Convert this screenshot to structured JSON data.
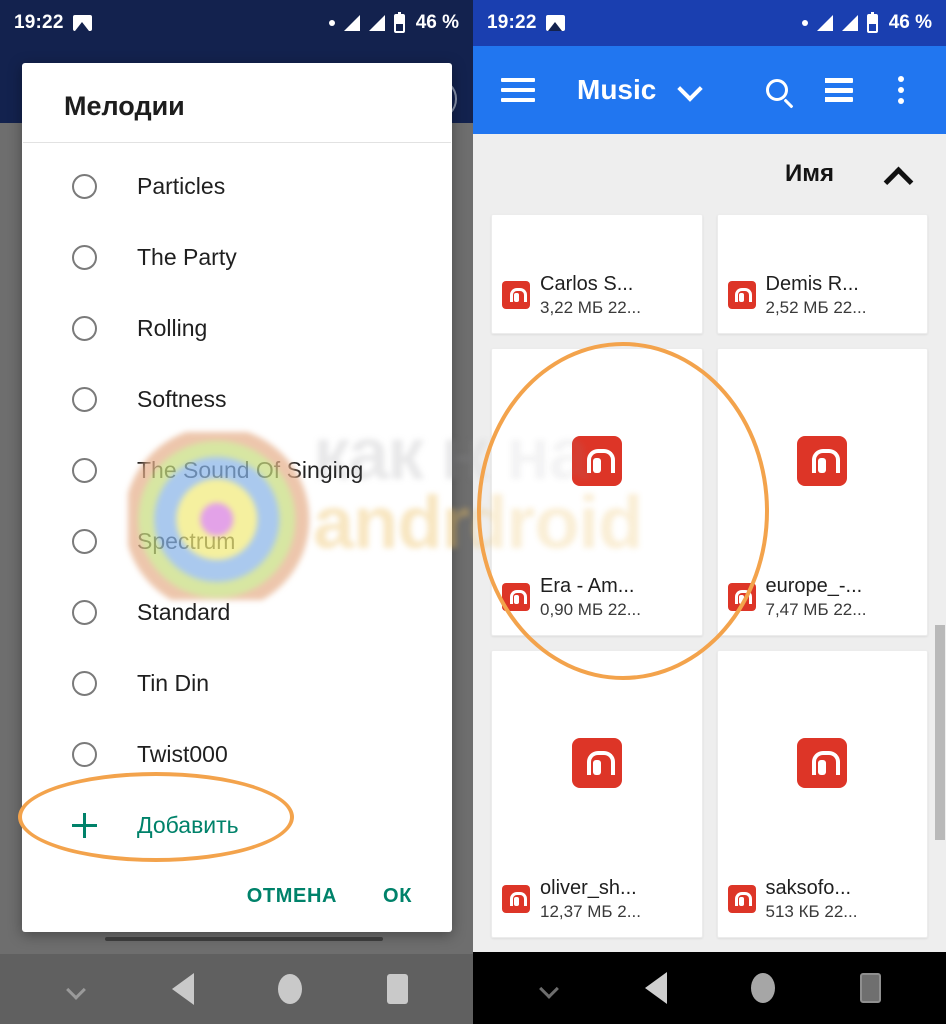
{
  "status_bar": {
    "time": "19:22",
    "battery_percent": "46 %",
    "image_icon": "image-icon",
    "dot_icon": "dot-icon",
    "signal_icon": "signal-icon",
    "battery_icon": "battery-icon"
  },
  "left": {
    "dialog": {
      "title": "Мелодии",
      "items": [
        {
          "label": "Particles",
          "selected": false
        },
        {
          "label": "The Party",
          "selected": false
        },
        {
          "label": "Rolling",
          "selected": false
        },
        {
          "label": "Softness",
          "selected": false
        },
        {
          "label": "The Sound Of Singing",
          "selected": false
        },
        {
          "label": "Spectrum",
          "selected": false
        },
        {
          "label": "Standard",
          "selected": false
        },
        {
          "label": "Tin Din",
          "selected": false
        },
        {
          "label": "Twist000",
          "selected": false
        }
      ],
      "add_label": "Добавить",
      "cancel_label": "ОТМЕНА",
      "ok_label": "ОК"
    },
    "highlight": {
      "shape": "ellipse",
      "target": "Добавить",
      "color": "#f3a34c"
    }
  },
  "right": {
    "appbar": {
      "title": "Music",
      "menu_icon": "hamburger-icon",
      "dropdown_icon": "chevron-down-icon",
      "search_icon": "search-icon",
      "view_icon": "list-view-icon",
      "overflow_icon": "more-vertical-icon"
    },
    "sort": {
      "label": "Имя",
      "direction_icon": "chevron-up-icon"
    },
    "files": [
      {
        "name": "Carlos S...",
        "meta": "3,22 МБ 22...",
        "layout": "short"
      },
      {
        "name": "Demis R...",
        "meta": "2,52 МБ 22...",
        "layout": "short"
      },
      {
        "name": "Era - Am...",
        "meta": "0,90 МБ 22...",
        "layout": "tall"
      },
      {
        "name": "europe_-...",
        "meta": "7,47 МБ 22...",
        "layout": "tall"
      },
      {
        "name": "oliver_sh...",
        "meta": "12,37 МБ 2...",
        "layout": "tall"
      },
      {
        "name": "saksofo...",
        "meta": "513 КБ 22...",
        "layout": "tall"
      }
    ],
    "highlight": {
      "shape": "ellipse",
      "target": "Era - Am...",
      "color": "#f3a34c"
    }
  },
  "watermark": {
    "line1": "как на",
    "line2": "android"
  },
  "navbar": {
    "hide_icon": "chevron-down-icon",
    "back_icon": "back-triangle-icon",
    "home_icon": "home-circle-icon",
    "recents_icon": "recents-square-icon"
  },
  "colors": {
    "left_status_bar": "#13224e",
    "right_status_bar": "#1a3fb0",
    "appbar": "#2176f0",
    "accent_green": "#00826a",
    "highlight_orange": "#f3a34c",
    "audio_icon_red": "#dd3527",
    "scrim_grey": "#6e6e6e"
  }
}
